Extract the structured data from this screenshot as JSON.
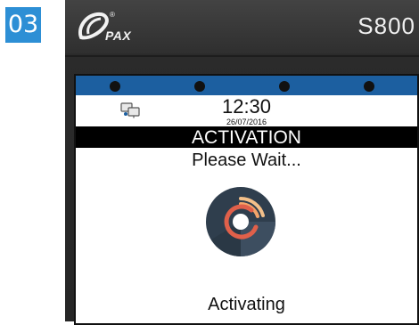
{
  "step": {
    "number": "03"
  },
  "device": {
    "brand": "PAX",
    "model": "S800"
  },
  "screen": {
    "time": "12:30",
    "date": "26/07/2016",
    "title": "ACTIVATION",
    "subtitle": "Please Wait...",
    "status": "Activating",
    "icons": {
      "network": "network-icon",
      "progress": "progress-spinner-icon"
    },
    "colors": {
      "status_bar": "#1c5fa0",
      "spinner_bg": "#2f3e4d",
      "spinner_red": "#e0604a",
      "spinner_tan": "#f3c08a"
    }
  }
}
